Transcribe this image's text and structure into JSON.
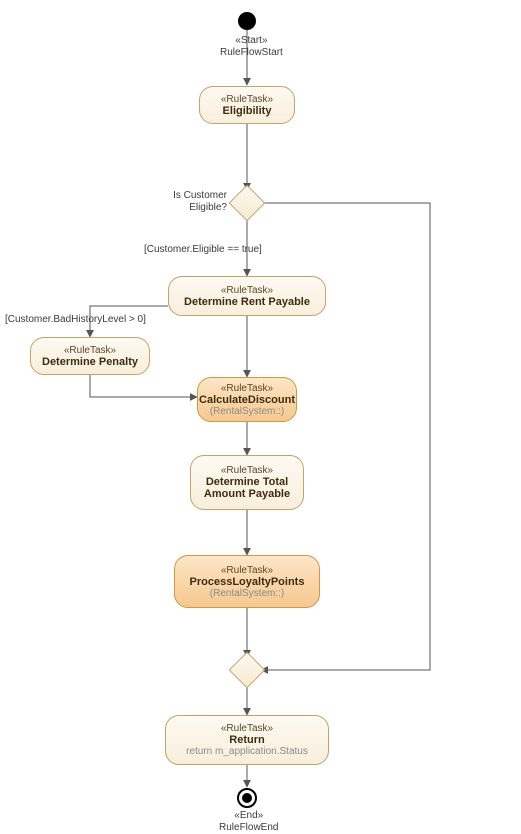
{
  "start": {
    "stereo": "«Start»",
    "name": "RuleFlowStart"
  },
  "eligibility": {
    "stereo": "«RuleTask»",
    "title": "Eligibility"
  },
  "decision1_label": "Is Customer\nEligible?",
  "guard_eligible": "[Customer.Eligible == true]",
  "guard_badhistory": "[Customer.BadHistoryLevel > 0]",
  "rentPayable": {
    "stereo": "«RuleTask»",
    "title": "Determine Rent Payable"
  },
  "penalty": {
    "stereo": "«RuleTask»",
    "title": "Determine Penalty"
  },
  "discount": {
    "stereo": "«RuleTask»",
    "title": "CalculateDiscount",
    "sub": "(RentalSystem::)"
  },
  "total": {
    "stereo": "«RuleTask»",
    "title": "Determine Total\nAmount Payable"
  },
  "loyalty": {
    "stereo": "«RuleTask»",
    "title": "ProcessLoyaltyPoints",
    "sub": "(RentalSystem::)"
  },
  "ret": {
    "stereo": "«RuleTask»",
    "title": "Return",
    "sub": "return m_application.Status"
  },
  "end": {
    "stereo": "«End»",
    "name": "RuleFlowEnd"
  }
}
